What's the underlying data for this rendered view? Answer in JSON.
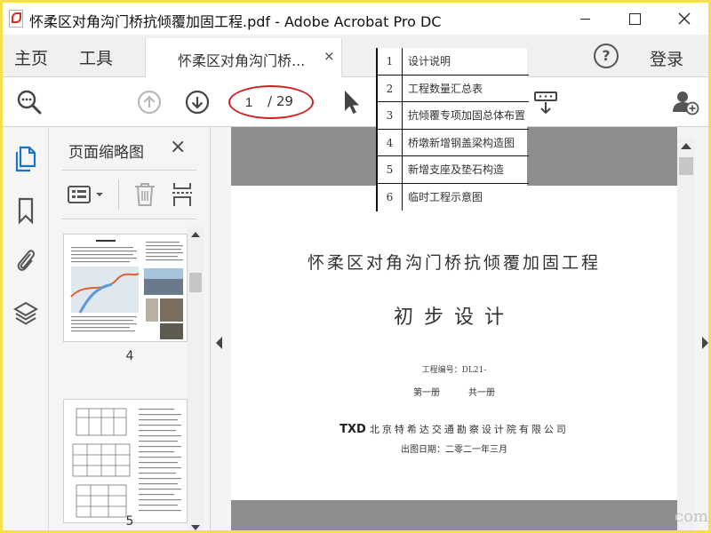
{
  "window": {
    "title": "怀柔区对角沟门桥抗倾覆加固工程.pdf - Adobe Acrobat Pro DC"
  },
  "nav": {
    "home": "主页",
    "tools": "工具",
    "tab_label": "怀柔区对角沟门桥...",
    "tab_close": "×",
    "help": "?",
    "login": "登录"
  },
  "toolbar": {
    "current_page": "1",
    "total_pages": "/ 29"
  },
  "thumbnails": {
    "title": "页面缩略图",
    "close": "×",
    "pages": [
      {
        "number": "4"
      },
      {
        "number": "5"
      }
    ]
  },
  "document": {
    "title": "怀柔区对角沟门桥抗倾覆加固工程",
    "subtitle": "初步设计",
    "project_code": "工程编号：DL21-",
    "volume": "第一册",
    "volume_total": "共一册",
    "logo": "TXD",
    "company": "北京特希达交通勘察设计院有限公司",
    "date": "出图日期：二零二一年三月"
  },
  "overlay_list": {
    "items": [
      {
        "num": "1",
        "text": "设计说明"
      },
      {
        "num": "2",
        "text": "工程数量汇总表"
      },
      {
        "num": "3",
        "text": "抗倾覆专项加固总体布置"
      },
      {
        "num": "4",
        "text": "桥墩新增钢盖梁构造图"
      },
      {
        "num": "5",
        "text": "新增支座及垫石构造"
      },
      {
        "num": "6",
        "text": "临时工程示意图"
      }
    ]
  },
  "watermark": "com",
  "colors": {
    "frame": "#f3e04a",
    "accent_blue": "#1a73c7",
    "annotation_red": "#d22020",
    "gray_band": "#8e8e8e"
  },
  "icons": {
    "search": "search-zoom-icon",
    "prev_page": "arrow-up-circle-icon",
    "next_page": "arrow-down-circle-icon",
    "select": "cursor-arrow-icon",
    "scroll": "scroll-mode-icon",
    "add_user": "add-user-icon",
    "thumbnails": "page-thumbnails-icon",
    "bookmarks": "bookmark-icon",
    "attachments": "paperclip-icon",
    "layers": "layers-icon"
  }
}
